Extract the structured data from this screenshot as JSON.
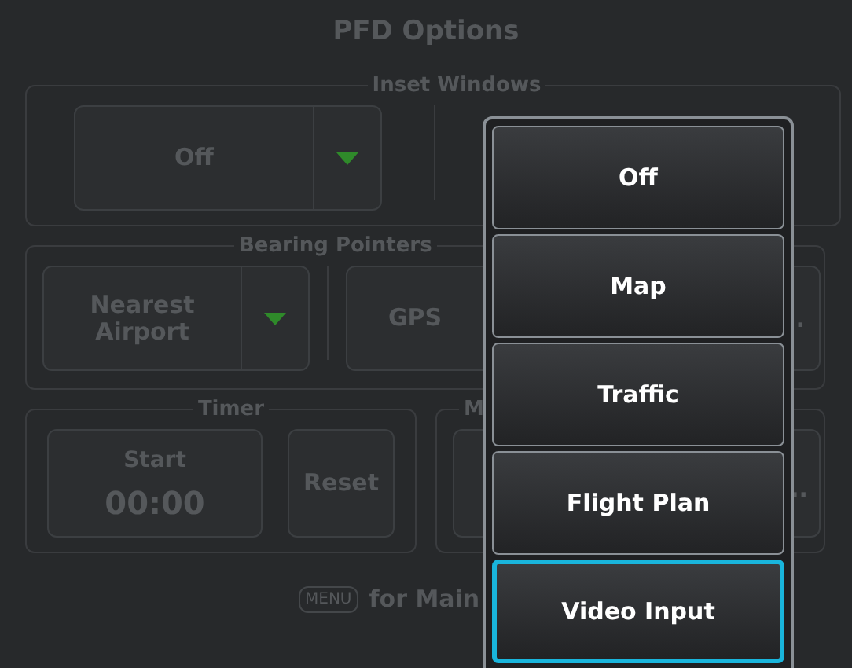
{
  "title": "PFD Options",
  "inset_windows": {
    "label": "Inset Windows",
    "selector": {
      "value": "Off"
    }
  },
  "bearing_pointers": {
    "label": "Bearing Pointers",
    "selectors": [
      {
        "kind": "dropdown",
        "value": "Nearest Airport"
      },
      {
        "kind": "button",
        "value": "GPS",
        "trailing": "."
      }
    ]
  },
  "timer": {
    "label": "Timer",
    "start_button": {
      "label": "Start",
      "time": "00:00"
    },
    "reset_button": "Reset"
  },
  "group_4": {
    "label": "M",
    "button_text": ".."
  },
  "footer": {
    "key": "MENU",
    "text": "for Main"
  },
  "popup": {
    "options": [
      {
        "label": "Off",
        "selected": false
      },
      {
        "label": "Map",
        "selected": false
      },
      {
        "label": "Traffic",
        "selected": false
      },
      {
        "label": "Flight Plan",
        "selected": false
      },
      {
        "label": "Video Input",
        "selected": true
      }
    ]
  }
}
